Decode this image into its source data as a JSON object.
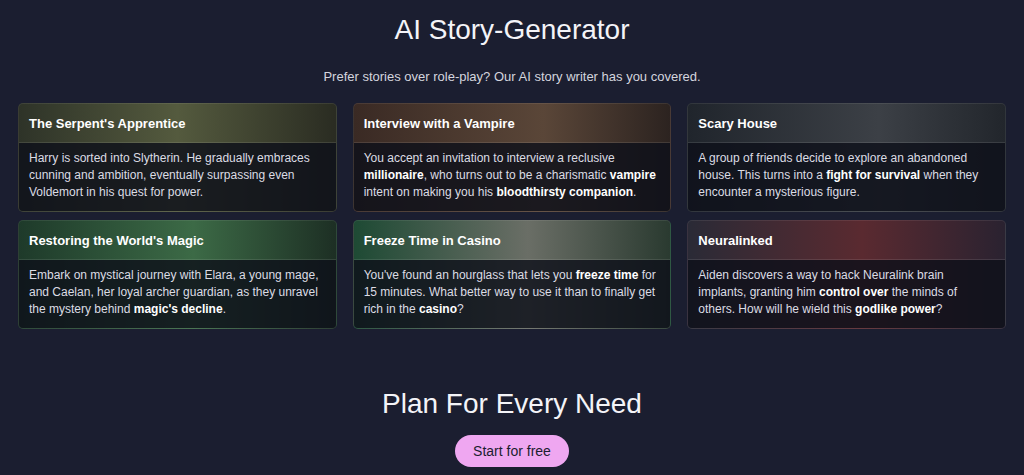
{
  "header": {
    "title": "AI Story-Generator",
    "subtitle": "Prefer stories over role-play? Our AI story writer has you covered."
  },
  "cards": [
    {
      "title": "The Serpent's Apprentice",
      "description": [
        {
          "text": "Harry is sorted into Slytherin. He gradually embraces cunning and ambition, eventually surpassing even Voldemort in his quest for power.",
          "highlight": false
        }
      ]
    },
    {
      "title": "Interview with a Vampire",
      "description": [
        {
          "text": "You accept an invitation to interview a reclusive ",
          "highlight": false
        },
        {
          "text": "millionaire",
          "highlight": true
        },
        {
          "text": ", who turns out to be a charismatic ",
          "highlight": false
        },
        {
          "text": "vampire",
          "highlight": true
        },
        {
          "text": " intent on making you his ",
          "highlight": false
        },
        {
          "text": "bloodthirsty companion",
          "highlight": true
        },
        {
          "text": ".",
          "highlight": false
        }
      ]
    },
    {
      "title": "Scary House",
      "description": [
        {
          "text": "A group of friends decide to explore an abandoned house. This turns into a ",
          "highlight": false
        },
        {
          "text": "fight for survival",
          "highlight": true
        },
        {
          "text": " when they encounter a mysterious figure.",
          "highlight": false
        }
      ]
    },
    {
      "title": "Restoring the World's Magic",
      "description": [
        {
          "text": "Embark on mystical journey with Elara, a young mage, and Caelan, her loyal archer guardian, as they unravel the mystery behind ",
          "highlight": false
        },
        {
          "text": "magic's decline",
          "highlight": true
        },
        {
          "text": ".",
          "highlight": false
        }
      ]
    },
    {
      "title": "Freeze Time in Casino",
      "description": [
        {
          "text": "You've found an hourglass that lets you ",
          "highlight": false
        },
        {
          "text": "freeze time",
          "highlight": true
        },
        {
          "text": " for 15 minutes. What better way to use it than to finally get rich in the ",
          "highlight": false
        },
        {
          "text": "casino",
          "highlight": true
        },
        {
          "text": "?",
          "highlight": false
        }
      ]
    },
    {
      "title": "Neuralinked",
      "description": [
        {
          "text": "Aiden discovers a way to hack Neuralink brain implants, granting him ",
          "highlight": false
        },
        {
          "text": "control over",
          "highlight": true
        },
        {
          "text": " the minds of others. How will he wield this ",
          "highlight": false
        },
        {
          "text": "godlike power",
          "highlight": true
        },
        {
          "text": "?",
          "highlight": false
        }
      ]
    }
  ],
  "plans": {
    "title": "Plan For Every Need",
    "button": "Start for free"
  }
}
